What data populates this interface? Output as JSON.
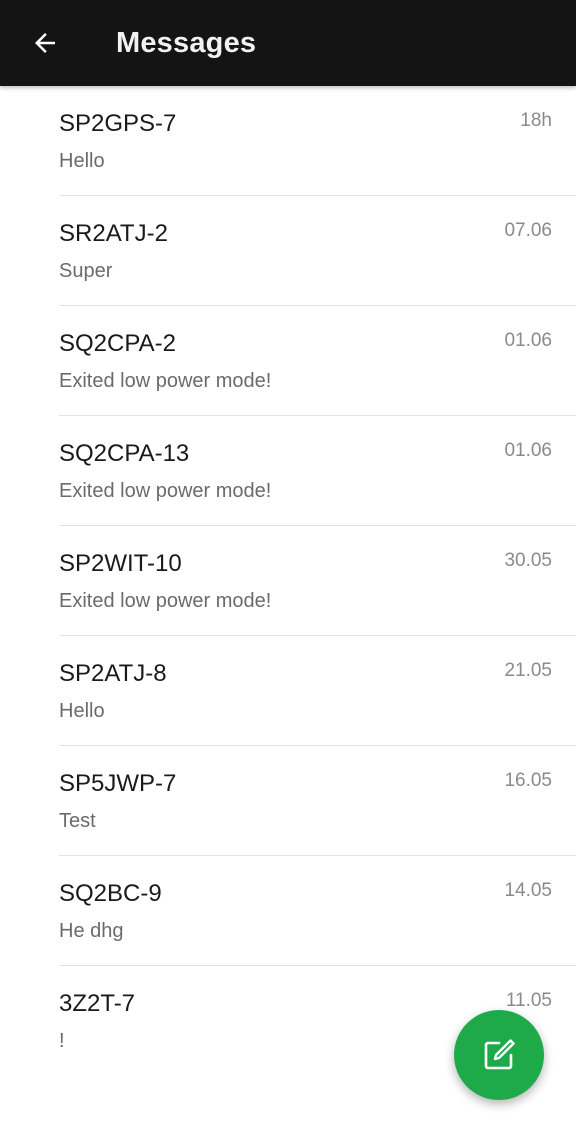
{
  "header": {
    "title": "Messages",
    "back_icon": "arrow-left-icon"
  },
  "colors": {
    "appbar": "#141414",
    "fab": "#1faa4a"
  },
  "messages": [
    {
      "callsign": "SP2GPS-7",
      "preview": "Hello",
      "time": "18h"
    },
    {
      "callsign": "SR2ATJ-2",
      "preview": "Super",
      "time": "07.06"
    },
    {
      "callsign": "SQ2CPA-2",
      "preview": "Exited low power mode!",
      "time": "01.06"
    },
    {
      "callsign": "SQ2CPA-13",
      "preview": "Exited low power mode!",
      "time": "01.06"
    },
    {
      "callsign": "SP2WIT-10",
      "preview": "Exited low power mode!",
      "time": "30.05"
    },
    {
      "callsign": "SP2ATJ-8",
      "preview": "Hello",
      "time": "21.05"
    },
    {
      "callsign": "SP5JWP-7",
      "preview": "Test",
      "time": "16.05"
    },
    {
      "callsign": "SQ2BC-9",
      "preview": "He dhg",
      "time": "14.05"
    },
    {
      "callsign": "3Z2T-7",
      "preview": "!",
      "time": "11.05"
    }
  ],
  "fab": {
    "icon": "compose-icon"
  }
}
